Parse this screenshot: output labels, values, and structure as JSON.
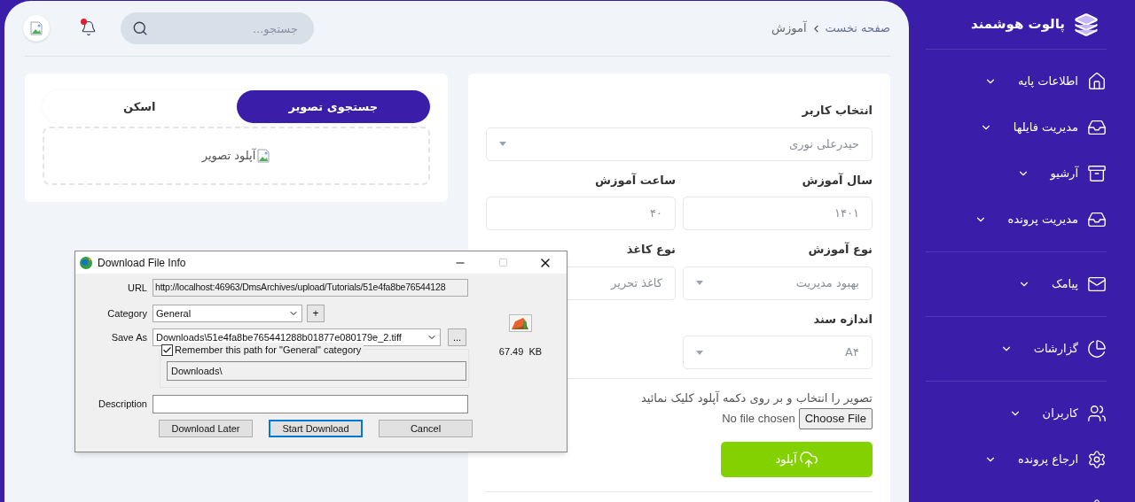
{
  "sidebar": {
    "brand": "پالوت هوشمند",
    "groups": [
      [
        {
          "label": "اطلاعات پایه"
        },
        {
          "label": "مدیریت فایلها"
        },
        {
          "label": "آرشیو"
        },
        {
          "label": "مدیریت پرونده"
        }
      ],
      [
        {
          "label": "پیامک"
        }
      ],
      [
        {
          "label": "گزارشات"
        }
      ],
      [
        {
          "label": "کاربران"
        },
        {
          "label": "ارجاع پرونده"
        }
      ]
    ]
  },
  "breadcrumb": [
    "صفحه نخست",
    "آموزش"
  ],
  "search": {
    "placeholder": "جستجو..."
  },
  "notifications": {
    "unread": true
  },
  "image_panel": {
    "tabs": [
      {
        "label": "جستجوی تصویر",
        "selected": true
      },
      {
        "label": "اسکن",
        "selected": false
      }
    ],
    "dropzone": {
      "label": "آپلود تصویر"
    }
  },
  "form": {
    "rows": [
      [
        {
          "kind": "select",
          "label": "انتخاب کاربر",
          "value": "حیدرعلی نوری"
        }
      ],
      [
        {
          "kind": "input",
          "label": "سال آموزش",
          "value": "۱۴۰۱"
        },
        {
          "kind": "input",
          "label": "ساعت آموزش",
          "value": "۴۰"
        }
      ],
      [
        {
          "kind": "select",
          "label": "نوع آموزش",
          "value": "بهبود مدیریت"
        },
        {
          "kind": "input",
          "label": "نوع کاغذ",
          "value": "کاغذ تحریر"
        }
      ],
      [
        {
          "kind": "select",
          "label": "اندازه سند",
          "value": "A۴"
        }
      ]
    ]
  },
  "upload": {
    "hint": "تصویر را انتخاب و بر روی دکمه آپلود کلیک نمائید",
    "file_button": "Choose File",
    "file_status": "No file chosen",
    "button": "آپلود"
  },
  "dialog": {
    "title": "Download File Info",
    "url_label": "URL",
    "url": "http://localhost:46963/DmsArchives/upload/Tutorials/51e4fa8be76544128",
    "category_label": "Category",
    "category": "General",
    "add_button": "+",
    "save_as_label": "Save As",
    "save_as": "Downloads\\51e4fa8be765441288b01877e080179e_2.tiff",
    "browse_button": "...",
    "remember": {
      "label": "Remember this path for \"General\" category",
      "checked": true
    },
    "folder": "Downloads\\",
    "description_label": "Description",
    "size": "67.49  KB",
    "later_button": {
      "label": "Download Later",
      "default": false
    },
    "start_button": {
      "label": "Start Download",
      "default": true
    },
    "cancel_button": {
      "label": "Cancel",
      "default": false
    }
  }
}
